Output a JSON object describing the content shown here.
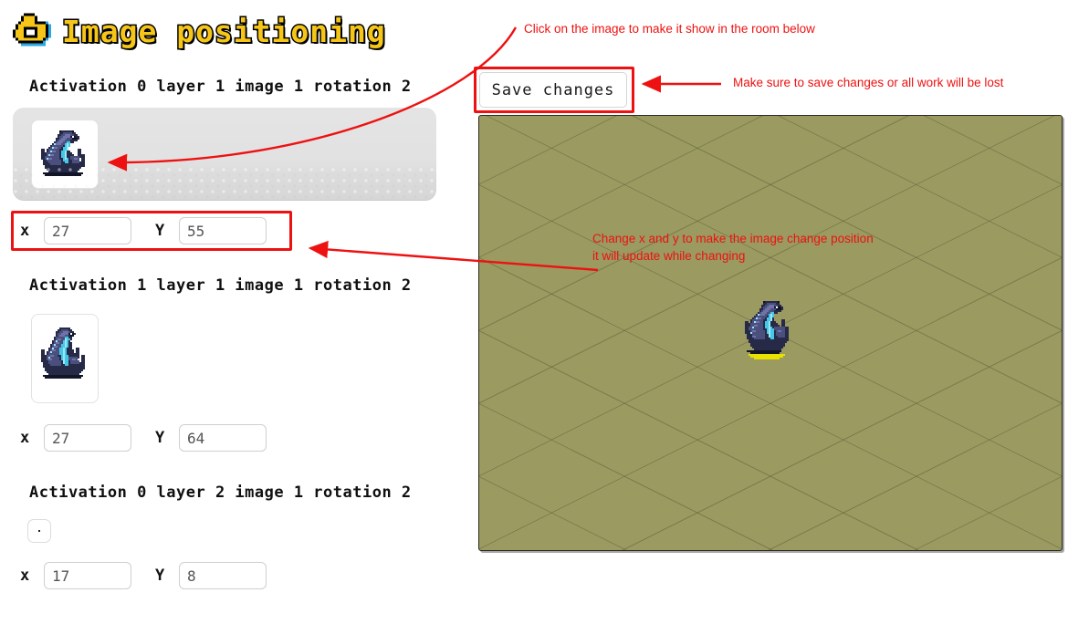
{
  "page": {
    "title": "Image positioning",
    "title_icon": "hand-pointer-icon",
    "accent_color": "#f5c518",
    "annotation_color": "#ee1111",
    "room_color": "#9a9a61"
  },
  "toolbar": {
    "save_label": "Save changes"
  },
  "annotations": [
    {
      "id": "click-image",
      "text": "Click on the image to make it show in the room below"
    },
    {
      "id": "save-warning",
      "text": "Make sure to save changes or all work will be lost"
    },
    {
      "id": "change-xy",
      "text": "Change x and y to make the image change position\nit will update while changing"
    }
  ],
  "sections": [
    {
      "label": "Activation 0 layer 1 image 1 rotation 2",
      "has_image": true,
      "x_label": "x",
      "y_label": "Y",
      "x_value": "27",
      "y_value": "55",
      "highlighted": true
    },
    {
      "label": "Activation 1 layer 1 image 1 rotation 2",
      "has_image": true,
      "x_label": "x",
      "y_label": "Y",
      "x_value": "27",
      "y_value": "64",
      "highlighted": false
    },
    {
      "label": "Activation 0 layer 2 image 1 rotation 2",
      "has_image": false,
      "x_label": "x",
      "y_label": "Y",
      "x_value": "17",
      "y_value": "8",
      "highlighted": false
    }
  ],
  "room": {
    "sprite_name": "blue-dragon-sprite",
    "tile_highlight_color": "#e8e000"
  }
}
